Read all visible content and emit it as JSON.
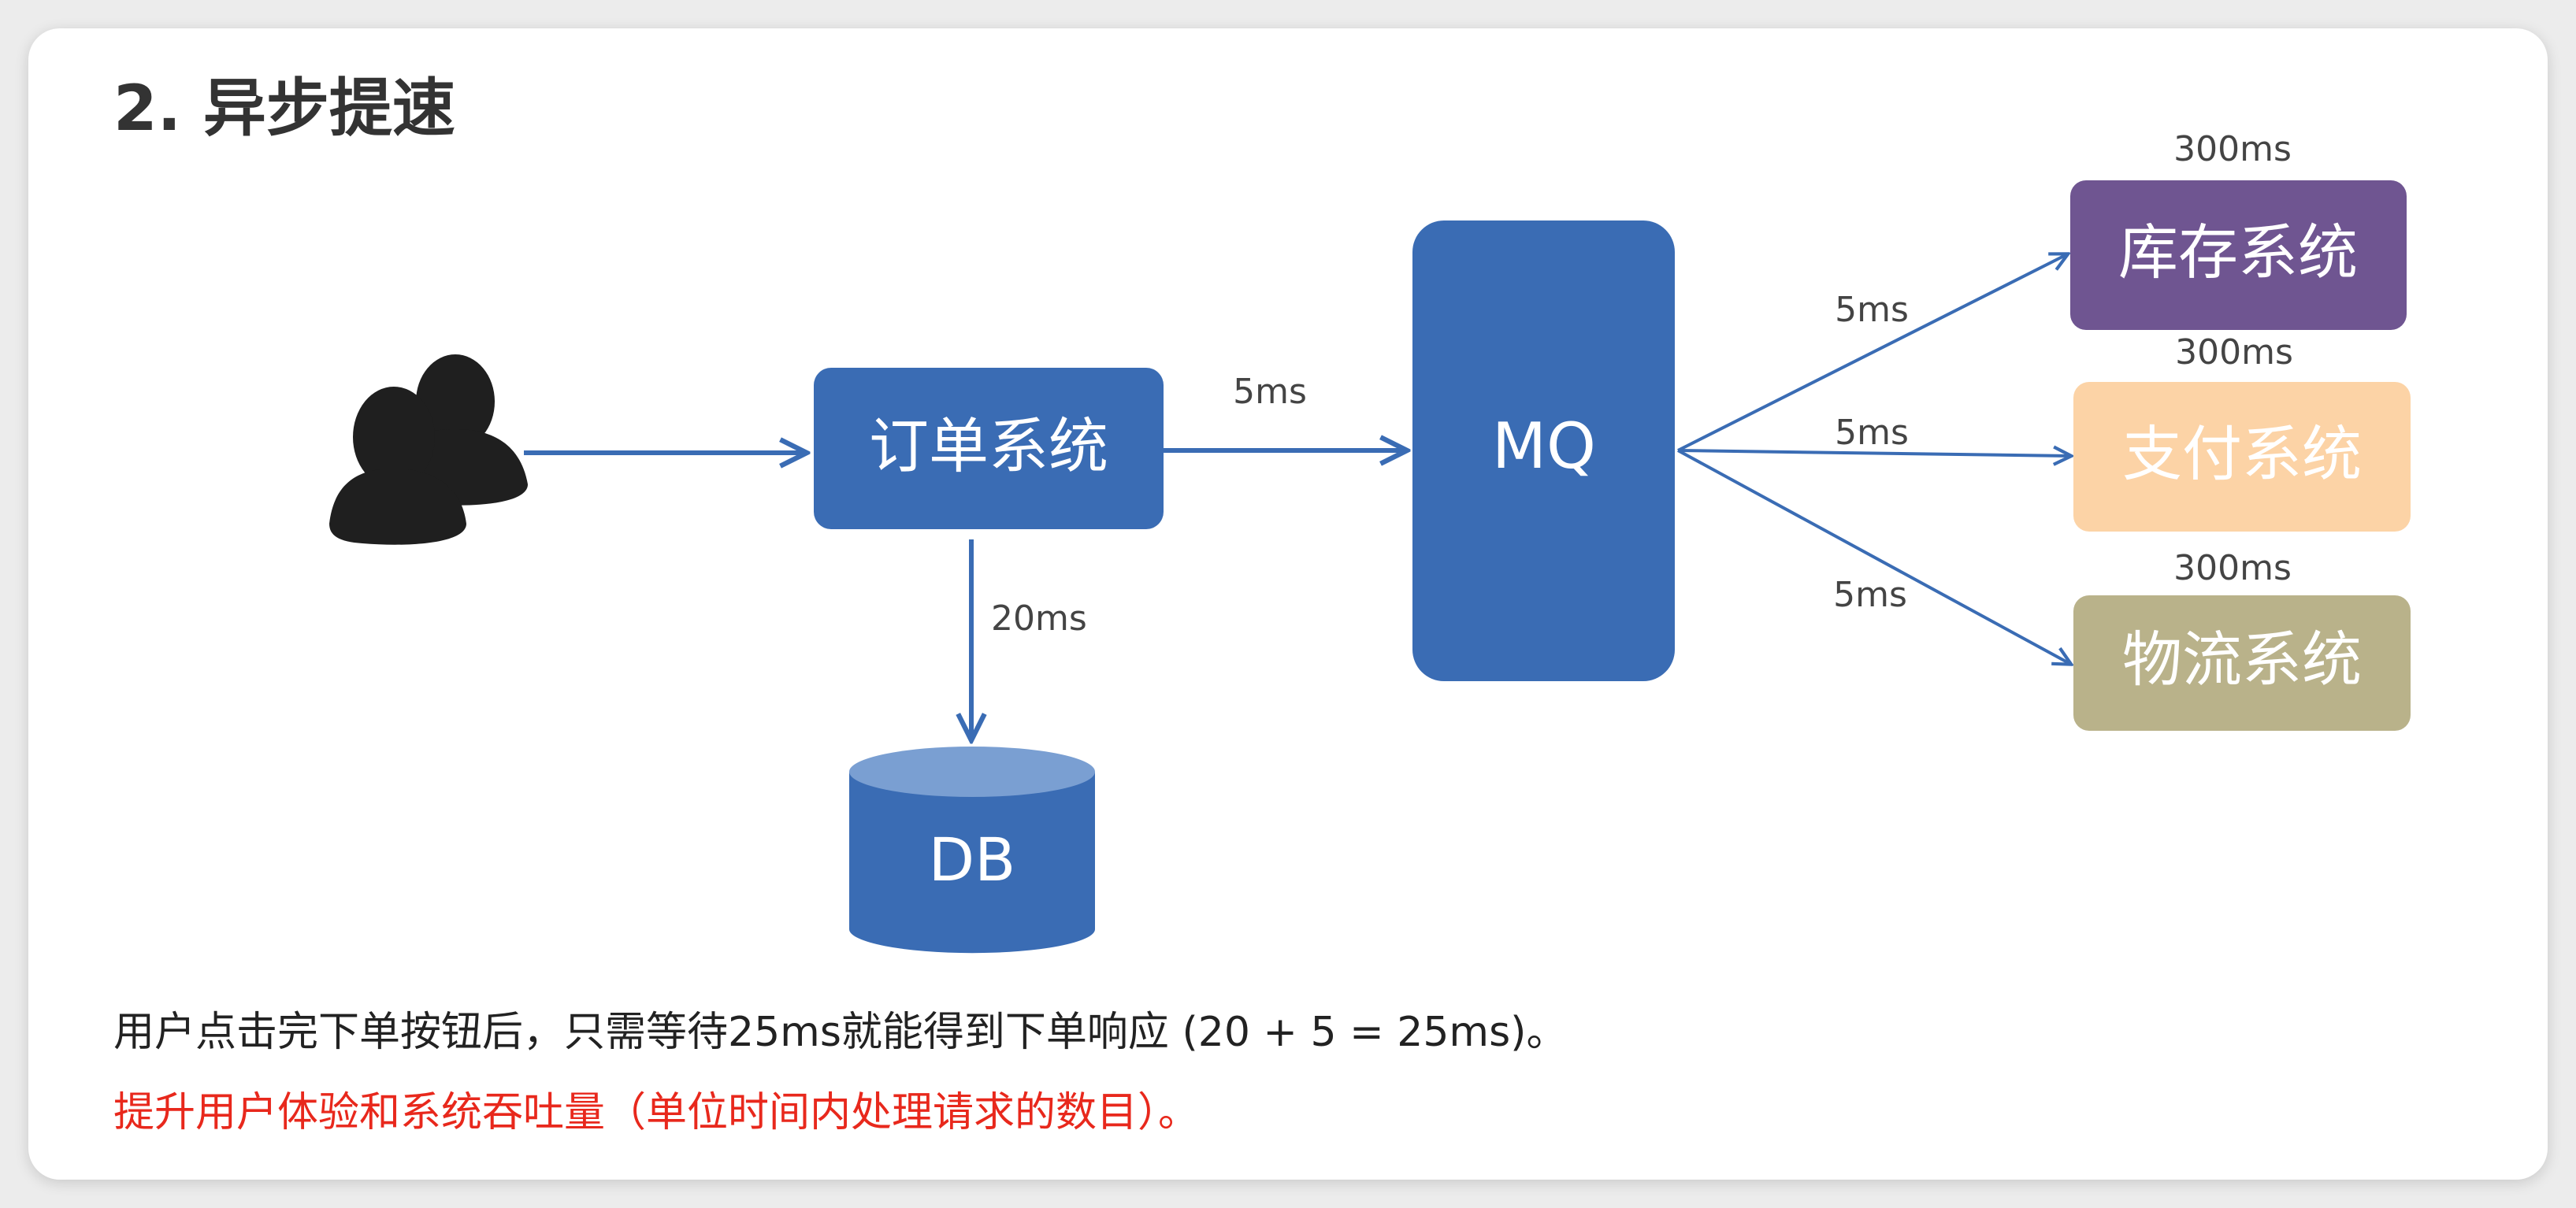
{
  "title": "2. 异步提速",
  "nodes": {
    "order": "订单系统",
    "mq": "MQ",
    "db": "DB",
    "inventory": "库存系统",
    "payment": "支付系统",
    "logistics": "物流系统"
  },
  "latencies": {
    "order_to_mq": "5ms",
    "order_to_db": "20ms",
    "mq_to_inventory": "5ms",
    "mq_to_payment": "5ms",
    "mq_to_logistics": "5ms",
    "inventory_time": "300ms",
    "payment_time": "300ms",
    "logistics_time": "300ms"
  },
  "colors": {
    "blue": "#3a6cb4",
    "inventory": "#6f5591",
    "payment": "#fcd3a6",
    "logistics": "#b9b28a",
    "red_text": "#e8281c"
  },
  "description": "用户点击完下单按钮后，只需等待25ms就能得到下单响应 (20 + 5 = 25ms)。",
  "highlight": "提升用户体验和系统吞吐量（单位时间内处理请求的数目）。"
}
